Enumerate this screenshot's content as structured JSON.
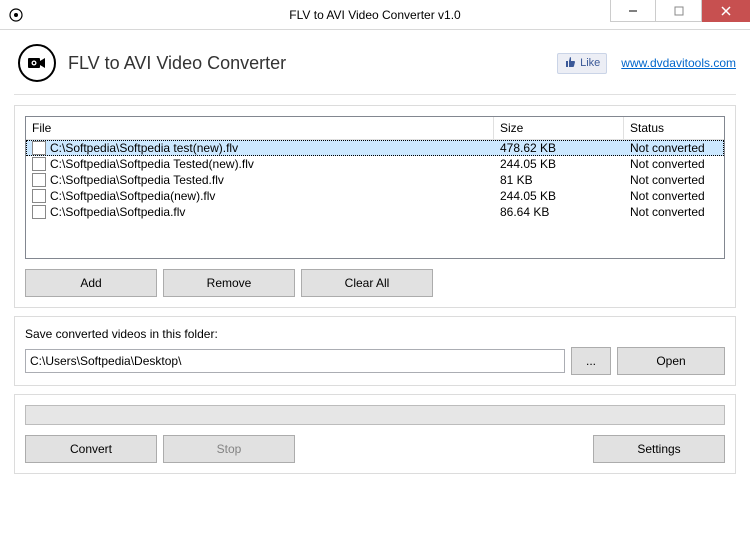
{
  "window": {
    "title": "FLV to AVI Video Converter v1.0"
  },
  "header": {
    "app_title": "FLV to AVI Video Converter",
    "like_label": "Like",
    "website_url": "www.dvdavitools.com"
  },
  "table": {
    "columns": {
      "file": "File",
      "size": "Size",
      "status": "Status"
    },
    "rows": [
      {
        "file": "C:\\Softpedia\\Softpedia test(new).flv",
        "size": "478.62 KB",
        "status": "Not converted",
        "selected": true
      },
      {
        "file": "C:\\Softpedia\\Softpedia Tested(new).flv",
        "size": "244.05 KB",
        "status": "Not converted",
        "selected": false
      },
      {
        "file": "C:\\Softpedia\\Softpedia Tested.flv",
        "size": "81 KB",
        "status": "Not converted",
        "selected": false
      },
      {
        "file": "C:\\Softpedia\\Softpedia(new).flv",
        "size": "244.05 KB",
        "status": "Not converted",
        "selected": false
      },
      {
        "file": "C:\\Softpedia\\Softpedia.flv",
        "size": "86.64 KB",
        "status": "Not converted",
        "selected": false
      }
    ]
  },
  "buttons": {
    "add": "Add",
    "remove": "Remove",
    "clear_all": "Clear All",
    "browse": "...",
    "open": "Open",
    "convert": "Convert",
    "stop": "Stop",
    "settings": "Settings"
  },
  "save": {
    "label": "Save converted videos in this folder:",
    "path": "C:\\Users\\Softpedia\\Desktop\\"
  }
}
